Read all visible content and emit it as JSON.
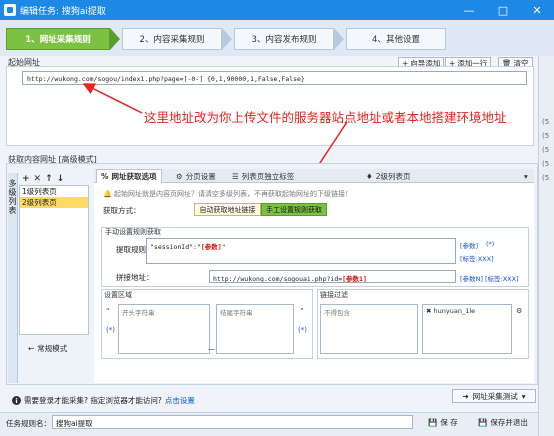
{
  "window": {
    "title": "编辑任务: 搜狗ai提取",
    "minimize": "—",
    "maximize": "□",
    "close": "✕"
  },
  "steps": [
    {
      "label": "1、网址采集规则",
      "active": true
    },
    {
      "label": "2、内容采集规则",
      "active": false
    },
    {
      "label": "3、内容发布规则",
      "active": false
    },
    {
      "label": "4、其他设置",
      "active": false
    }
  ],
  "start_url": {
    "section_label": "起始网址",
    "wizard_add": "向导添加",
    "add_line": "添加一行",
    "clear": "清空",
    "value": "http://wukong.com/sogou/index1.php?page=[-0-] {0,1,90000,1,False,False}"
  },
  "annotation": "这里地址改为你上传文件的服务器站点地址或者本地搭建环境地址",
  "fetch": {
    "section_label": "获取内容网址 [高级模式]",
    "vertical_tab": "多级列表",
    "levels": [
      "1级列表页",
      "2级列表页"
    ],
    "normal_mode": "常规模式",
    "tabs": [
      {
        "label": "网址获取选项",
        "active": true
      },
      {
        "label": "分页设置",
        "active": false
      },
      {
        "label": "列表页独立标签",
        "active": false
      },
      {
        "label": "2级列表页",
        "active": false
      }
    ],
    "hint": "起始网址就是内容页网址？请清空多级列表，不再获取起始网址的下级链接！",
    "method_label": "获取方式：",
    "auto_btn": "自动获取地址链接",
    "manual_btn": "手工设置规则获取",
    "manual_group_title": "手动设置规则获取",
    "rule_label": "提取规则：",
    "rule_prefix": "\"sessionId\":\"",
    "rule_param": "[参数]",
    "rule_suffix": "\"",
    "param_link": "[参数]",
    "param_star": "(*)",
    "label_link": "[标签:XXX]",
    "sample_label": "拼接地址：",
    "sample_prefix": "http://wukong.com/sogouai.php?id=",
    "sample_param": "[参数1]",
    "sample_links": "[参数N] [标签:XXX]",
    "range_title": "设置区域",
    "range_start_token": "“",
    "range_start": "开头字符串",
    "range_end": "结尾字符串",
    "range_end_token": "”",
    "range_star": "(*)",
    "range_dash": "—",
    "filter_title": "链接过滤",
    "filter_exclude": "不得包含",
    "filter_include": "hunyuan_1le"
  },
  "bottom": {
    "login_hint": "需要登录才能采集? 指定浏览器才能访问?",
    "login_link": "点击设置",
    "test_btn": "网址采集测试",
    "name_label": "任务规则名：",
    "name_value": "搜狗ai提取",
    "save": "保 存",
    "save_exit": "保存并退出"
  },
  "right_edge": [
    "(5",
    "(5",
    "(5",
    "(5",
    "(5"
  ],
  "colors": {
    "titlebar": "#1e88e5",
    "step_active": "#7cc242",
    "annotation": "#e6231e",
    "param_red": "#d8180e"
  }
}
